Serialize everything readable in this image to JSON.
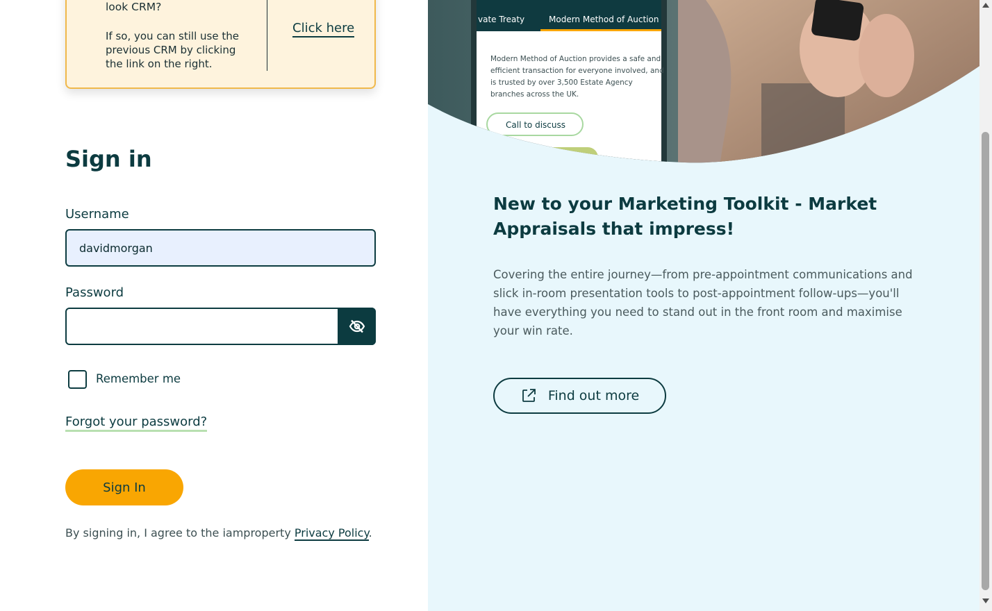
{
  "notice": {
    "question_text": "look CRM?",
    "message": "If so, you can still use the previous CRM by clicking the link on the right.",
    "link_label": "Click here"
  },
  "signin": {
    "title": "Sign in",
    "username_label": "Username",
    "username_value": "davidmorgan",
    "password_label": "Password",
    "password_value": "",
    "remember_label": "Remember me",
    "forgot_label": "Forgot your password?",
    "button_label": "Sign In",
    "agree_text": "By signing in, I agree to the iamproperty ",
    "privacy_link": "Privacy Policy",
    "agree_end": "."
  },
  "promo": {
    "phone_tab_1": "vate Treaty",
    "phone_tab_2": "Modern Method of Auction",
    "phone_text_1": "Modern Method of Auction provides a safe and",
    "phone_text_2": "efficient transaction for everyone involved, and",
    "phone_text_3": "is trusted by over 3,500 Estate Agency",
    "phone_text_4": "branches across the UK.",
    "phone_button": "Call to discuss",
    "heading": "New to your Marketing Toolkit - Market Appraisals that impress!",
    "paragraph": "Covering the entire journey—from pre-appointment communications and slick in-room presentation tools to post-appointment follow-ups—you'll have everything you need to stand out in the front room and maximise your win rate.",
    "button_label": "Find out more"
  },
  "colors": {
    "primary": "#0c3b40",
    "accent": "#f9a602",
    "notice_bg": "#fef3dd",
    "panel_bg": "#e8f7fc"
  },
  "icons": {
    "password_toggle": "eye-off-icon",
    "find_out_more": "external-link-icon"
  }
}
